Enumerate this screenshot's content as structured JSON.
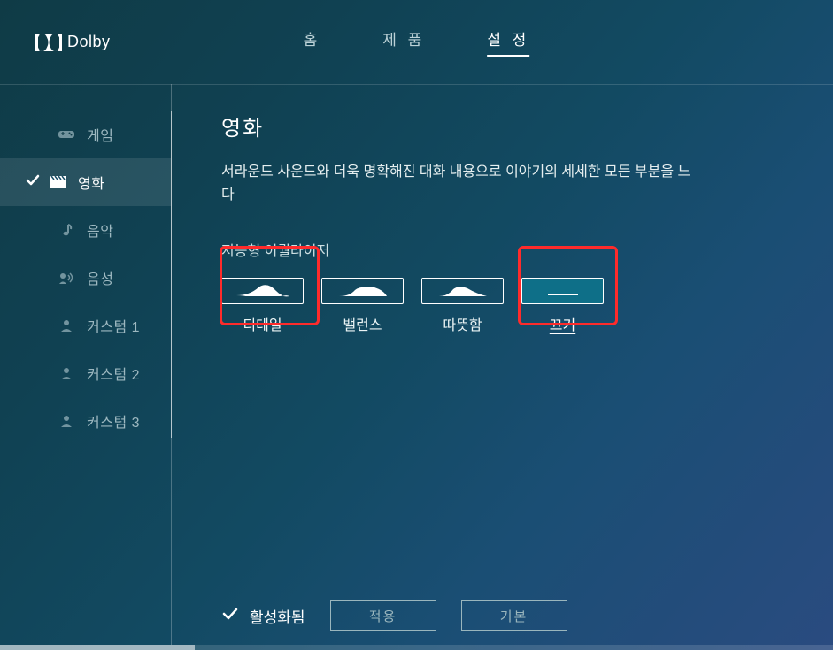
{
  "header": {
    "brand": "Dolby",
    "nav": {
      "home": "홈",
      "products": "제 품",
      "settings": "설 정"
    }
  },
  "sidebar": {
    "items": [
      {
        "label": "게임"
      },
      {
        "label": "영화"
      },
      {
        "label": "음악"
      },
      {
        "label": "음성"
      },
      {
        "label": "커스텀 1"
      },
      {
        "label": "커스텀 2"
      },
      {
        "label": "커스텀 3"
      }
    ]
  },
  "content": {
    "title": "영화",
    "description": "서라운드 사운드와 더욱 명확해진 대화 내용으로 이야기의 세세한 모든 부분을 느\n다",
    "eq_label": "지능형 이퀄라이저",
    "eq": {
      "detail": "디테일",
      "balance": "밸런스",
      "warm": "따뜻함",
      "off": "끄기"
    },
    "status": "활성화됨",
    "apply": "적용",
    "reset": "기본"
  }
}
